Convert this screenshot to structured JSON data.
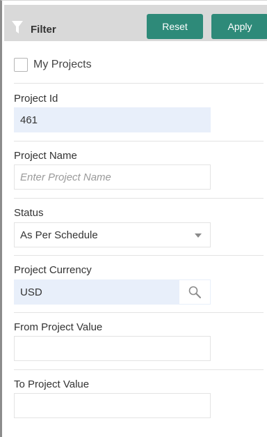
{
  "header": {
    "title": "Filter",
    "reset_label": "Reset",
    "apply_label": "Apply"
  },
  "my_projects": {
    "label": "My Projects",
    "checked": false
  },
  "fields": {
    "project_id": {
      "label": "Project Id",
      "value": "461"
    },
    "project_name": {
      "label": "Project Name",
      "value": "",
      "placeholder": "Enter Project Name"
    },
    "status": {
      "label": "Status",
      "value": "As Per Schedule"
    },
    "project_currency": {
      "label": "Project Currency",
      "value": "USD"
    },
    "from_project_value": {
      "label": "From Project Value",
      "value": ""
    },
    "to_project_value": {
      "label": "To Project Value",
      "value": ""
    }
  },
  "colors": {
    "button": "#2e8a79",
    "header_bg": "#d9d9d9",
    "filled_field_bg": "#e8effa"
  },
  "icons": {
    "filter": "filter-icon",
    "dropdown": "chevron-down-icon",
    "lookup": "search-icon"
  }
}
